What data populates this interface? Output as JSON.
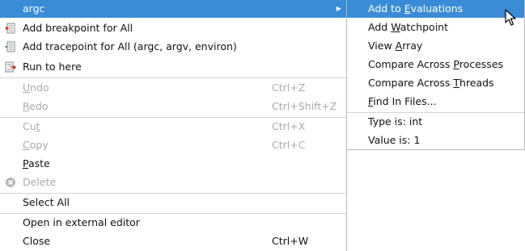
{
  "main_menu": {
    "header": {
      "label": "argc"
    },
    "items": [
      {
        "label": "Add breakpoint for All"
      },
      {
        "label": "Add tracepoint for All (argc, argv, environ)"
      },
      {
        "label": "Run to here"
      },
      {
        "pre": "",
        "u": "U",
        "post": "ndo",
        "shortcut": "Ctrl+Z"
      },
      {
        "pre": "",
        "u": "R",
        "post": "edo",
        "shortcut": "Ctrl+Shift+Z"
      },
      {
        "pre": "Cu",
        "u": "t",
        "post": "",
        "shortcut": "Ctrl+X"
      },
      {
        "pre": "",
        "u": "C",
        "post": "opy",
        "shortcut": "Ctrl+C"
      },
      {
        "pre": "",
        "u": "P",
        "post": "aste"
      },
      {
        "label": "Delete"
      },
      {
        "label": "Select All"
      },
      {
        "label": "Open in external editor"
      },
      {
        "label": "Close",
        "shortcut": "Ctrl+W"
      }
    ]
  },
  "sub_menu": {
    "items": [
      {
        "pre": "Add to ",
        "u": "E",
        "post": "valuations"
      },
      {
        "pre": "Add ",
        "u": "W",
        "post": "atchpoint"
      },
      {
        "pre": "View ",
        "u": "A",
        "post": "rray"
      },
      {
        "pre": "Compare Across ",
        "u": "P",
        "post": "rocesses"
      },
      {
        "pre": "Compare Across ",
        "u": "T",
        "post": "hreads"
      },
      {
        "pre": "",
        "u": "F",
        "post": "ind In Files..."
      },
      {
        "label": "Type is: int"
      },
      {
        "label": "Value is: 1"
      }
    ]
  },
  "colors": {
    "highlight": "#3a8cd7",
    "disabled_text": "#a9a9a9"
  },
  "icons": {
    "submenu_arrow": "triangle-right-icon",
    "breakpoint": "breakpoint-icon",
    "tracepoint": "tracepoint-icon",
    "run_to_here": "run-to-here-icon",
    "delete": "delete-icon"
  }
}
